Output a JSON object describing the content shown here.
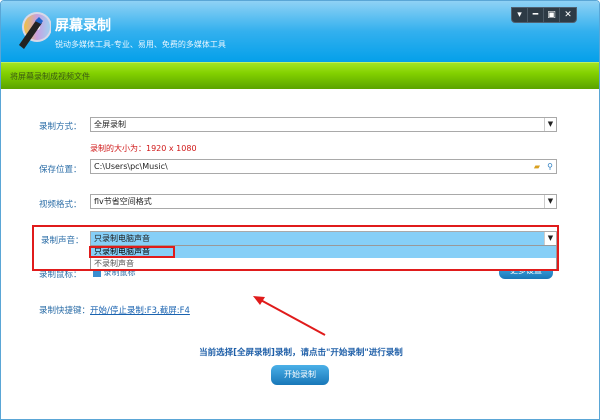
{
  "app": {
    "title": "屏幕录制",
    "subtitle": "锐动多媒体工具-专业、易用、免费的多媒体工具",
    "logo_icon": "cd-pen-icon"
  },
  "window_controls": [
    "menu",
    "minimize",
    "maximize",
    "close"
  ],
  "section_title": "将屏幕录制成视频文件",
  "form": {
    "mode_label": "录制方式：",
    "mode_value": "全屏录制",
    "size_note": "录制的大小为：1920 x 1080",
    "save_label": "保存位置：",
    "save_value": "C:\\Users\\pc\\Music\\",
    "format_label": "视频格式：",
    "format_value": "flv节省空间格式",
    "audio_label": "录制声音：",
    "audio_value": "只录制电脑声音",
    "audio_options": [
      "只录制电脑声音",
      "不录制声音"
    ],
    "mouse_label": "录制鼠标：",
    "mouse_checkbox": "录制鼠标",
    "more_settings": "更多设置",
    "hotkey_label": "录制快捷键：",
    "hotkey_value": "开始/停止录制:F3,截屏:F4"
  },
  "status_text": "当前选择[全屏录制]录制，请点击\"开始录制\"进行录制",
  "start_button": "开始录制",
  "colors": {
    "header": "#04a0ea",
    "green": "#82d000",
    "highlight": "#e01b1b"
  }
}
